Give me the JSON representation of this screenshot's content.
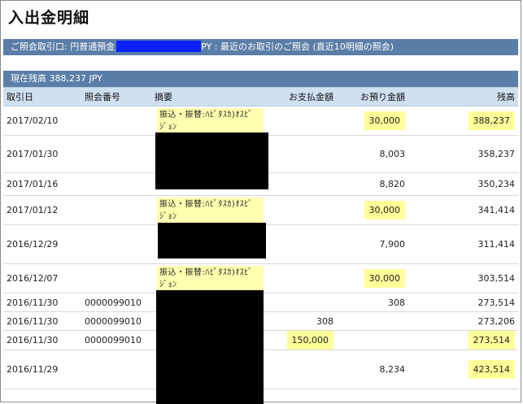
{
  "page": {
    "title": "入出金明細"
  },
  "inquiry": {
    "prefix": "ご照会取引口: 円普通預金",
    "suffix": "PY : 最近のお取引のご照会 (直近10明細の照会)"
  },
  "balance": {
    "label": "現在残高 388,237 JPY"
  },
  "table": {
    "headers": {
      "date": "取引日",
      "ref": "照会番号",
      "memo": "摘要",
      "payment": "お支払金額",
      "deposit": "お預り金額",
      "balance": "残高"
    },
    "rows": [
      {
        "date": "2017/02/10",
        "ref": "",
        "memo": "振込・振替:ﾊﾋﾟﾀｽｶ)ｵｽﾋﾟｼﾞｮﾝ",
        "payment": "",
        "deposit": "30,000",
        "balance": "388,237"
      },
      {
        "date": "2017/01/30",
        "ref": "",
        "memo": "",
        "payment": "",
        "deposit": "8,003",
        "balance": "358,237"
      },
      {
        "date": "2017/01/16",
        "ref": "",
        "memo": "",
        "payment": "",
        "deposit": "8,820",
        "balance": "350,234"
      },
      {
        "date": "2017/01/12",
        "ref": "",
        "memo": "振込・振替:ﾊﾋﾟﾀｽｶ)ｵｽﾋﾟｼﾞｮﾝ",
        "payment": "",
        "deposit": "30,000",
        "balance": "341,414"
      },
      {
        "date": "2016/12/29",
        "ref": "",
        "memo": "",
        "payment": "",
        "deposit": "7,900",
        "balance": "311,414"
      },
      {
        "date": "2016/12/07",
        "ref": "",
        "memo": "振込・振替:ﾊﾋﾟﾀｽｶ)ｵｽﾋﾟｼﾞｮﾝ",
        "payment": "",
        "deposit": "30,000",
        "balance": "303,514"
      },
      {
        "date": "2016/11/30",
        "ref": "0000099010",
        "memo": "",
        "payment": "",
        "deposit": "308",
        "balance": "273,514"
      },
      {
        "date": "2016/11/30",
        "ref": "0000099010",
        "memo": "",
        "payment": "308",
        "deposit": "",
        "balance": "273,206"
      },
      {
        "date": "2016/11/30",
        "ref": "0000099010",
        "memo": "",
        "payment": "150,000",
        "deposit": "",
        "balance": "273,514"
      },
      {
        "date": "2016/11/29",
        "ref": "",
        "memo": "",
        "payment": "",
        "deposit": "8,234",
        "balance": "423,514"
      }
    ]
  },
  "colors": {
    "header_bar": "#5b7ea8",
    "column_header": "#cfe0ef",
    "highlight": "#ffff9a",
    "redaction_blue": "#0a22ff"
  }
}
